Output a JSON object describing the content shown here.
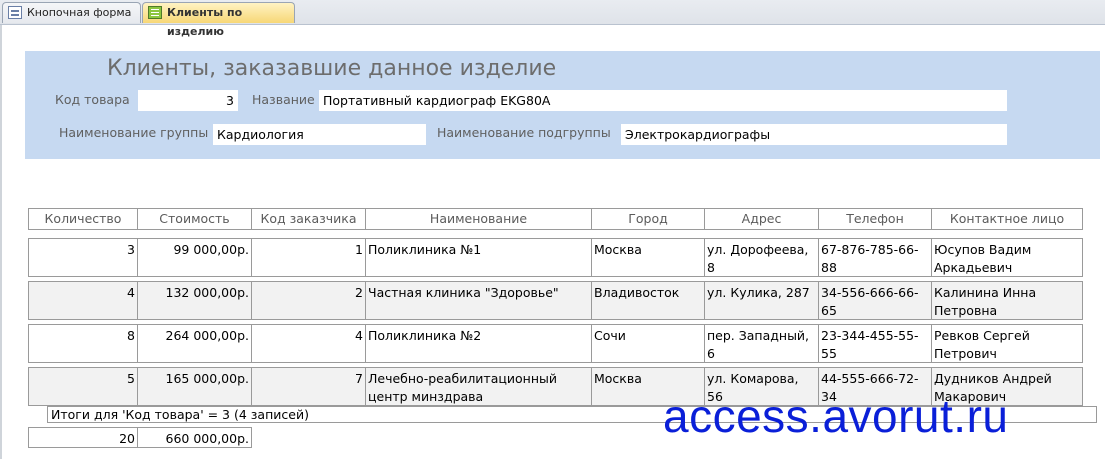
{
  "tabs": [
    {
      "label": "Кнопочная форма",
      "icon": "switchboard-form-icon",
      "active": false
    },
    {
      "label": "Клиенты по изделию",
      "icon": "report-icon",
      "active": true
    }
  ],
  "header": {
    "title": "Клиенты, заказавшие данное изделие",
    "product_code_label": "Код товара",
    "product_code": "3",
    "name_label": "Название",
    "name": "Портативный кардиограф EKG80A",
    "group_label": "Наименование группы",
    "group": "Кардиология",
    "subgroup_label": "Наименование подгруппы",
    "subgroup": "Электрокардиографы"
  },
  "table": {
    "columns": [
      "Количество",
      "Стоимость",
      "Код заказчика",
      "Наименование",
      "Город",
      "Адрес",
      "Телефон",
      "Контактное лицо"
    ],
    "rows": [
      [
        "3",
        "99 000,00р.",
        "1",
        "Поликлиника №1",
        "Москва",
        "ул. Дорофеева, 8",
        "67-876-785-66-88",
        "Юсупов Вадим Аркадьевич"
      ],
      [
        "4",
        "132 000,00р.",
        "2",
        "Частная клиника \"Здоровье\"",
        "Владивосток",
        "ул. Кулика, 287",
        "34-556-666-66-65",
        "Калинина Инна Петровна"
      ],
      [
        "8",
        "264 000,00р.",
        "4",
        "Поликлиника №2",
        "Сочи",
        "пер. Западный, 6",
        "23-344-455-55-55",
        "Ревков Сергей Петрович"
      ],
      [
        "5",
        "165 000,00р.",
        "7",
        "Лечебно-реабилитационный центр минздрава",
        "Москва",
        "ул. Комарова, 56",
        "44-555-666-72-34",
        "Дудников Андрей Макарович"
      ]
    ]
  },
  "summary": {
    "text": "Итоги для 'Код товара' =  3 (4 записей)",
    "total_quantity": "20",
    "total_cost": "660 000,00р."
  },
  "watermark": "access.avorut.ru",
  "colors": {
    "header_bg": "#c6d9f1",
    "alt_row": "#f2f2f2",
    "watermark": "#0a1fd8"
  }
}
